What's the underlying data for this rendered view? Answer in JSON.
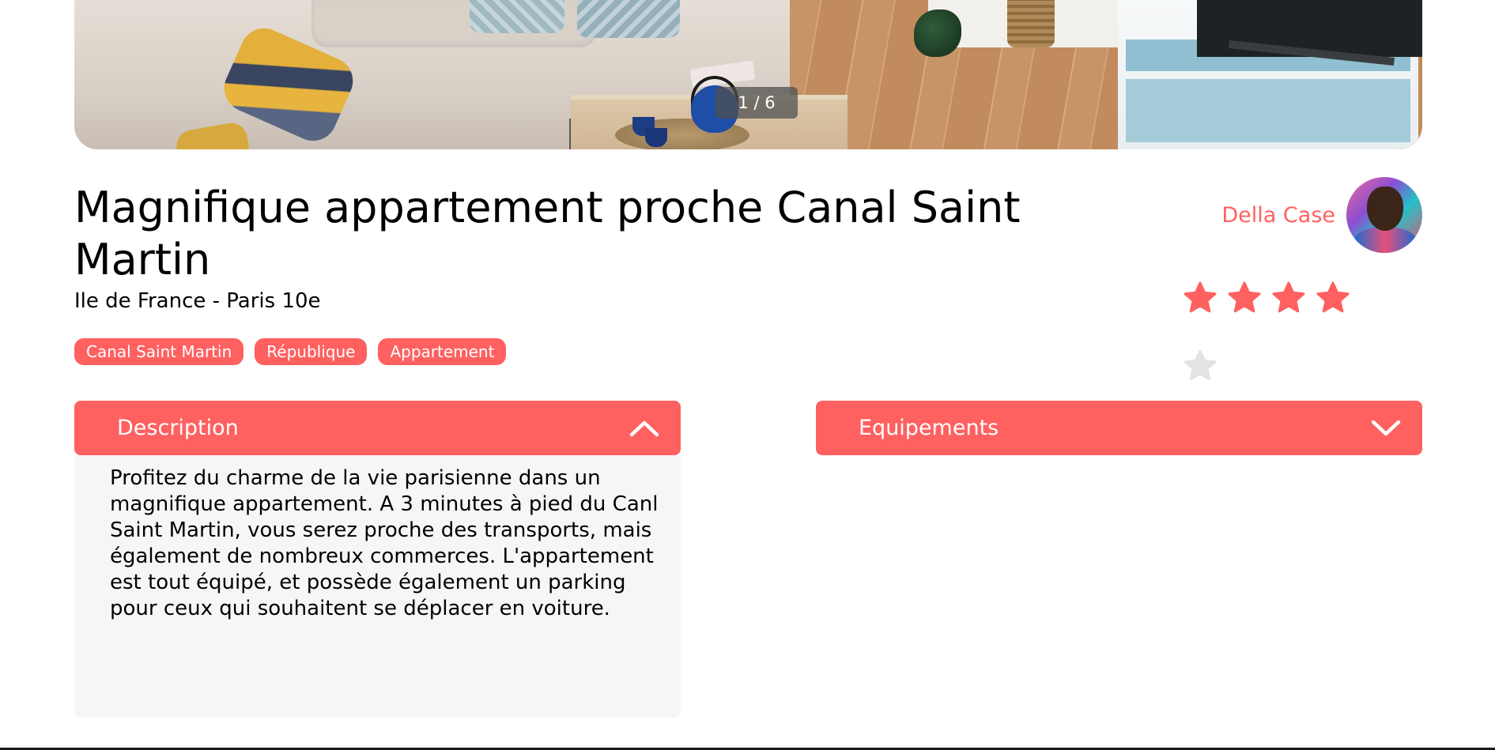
{
  "gallery": {
    "counter": "1 / 6",
    "image_alt": "Salon avec canapé, table basse, théière bleue et meuble TV"
  },
  "listing": {
    "title": "Magnifique appartement proche Canal Saint Martin",
    "location": "Ile de France - Paris 10e",
    "tags": [
      "Canal Saint Martin",
      "République",
      "Appartement"
    ]
  },
  "host": {
    "name": "Della Case",
    "avatar_icon": "host-avatar-photo"
  },
  "rating": {
    "value": 4,
    "max": 5,
    "filled_color": "#ff6060",
    "empty_color": "#e3e3e3"
  },
  "collapses": {
    "description": {
      "title": "Description",
      "state": "open",
      "icon": "chevron-up-icon",
      "text": "Profitez du charme de la vie parisienne dans un magnifique appartement. A 3 minutes à pied du Canl Saint Martin, vous serez proche des transports, mais également de nombreux commerces. L'appartement est tout équipé, et possède également un parking pour ceux qui souhaitent se déplacer en voiture."
    },
    "equipements": {
      "title": "Equipements",
      "state": "closed",
      "icon": "chevron-down-icon"
    }
  },
  "colors": {
    "accent": "#ff6060",
    "panel_bg": "#f6f6f6",
    "text": "#000000"
  }
}
